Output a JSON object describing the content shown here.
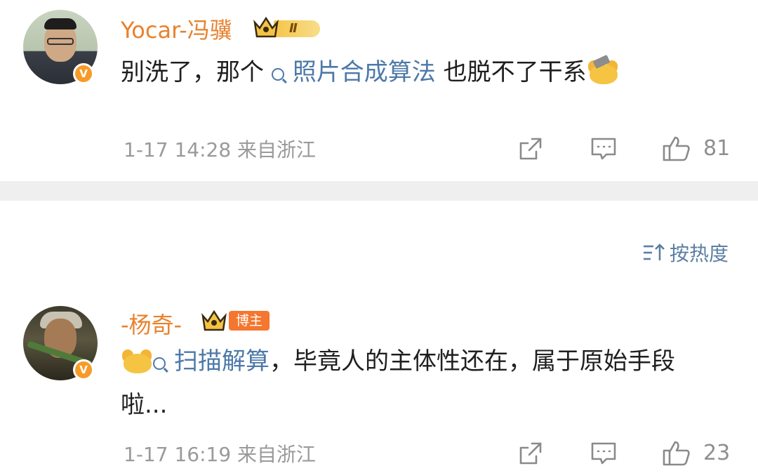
{
  "comments": [
    {
      "username": "Yocar-冯骥",
      "badge": "Ⅱ",
      "verified": "V",
      "text_before": "别洗了，那个",
      "link": "照片合成算法",
      "text_after": "也脱不了干系",
      "emoji": "hammer-emoji",
      "time": "1-17 14:28",
      "location": "来自浙江",
      "likes": "81"
    },
    {
      "username": "-杨奇-",
      "badge": "博主",
      "verified": "V",
      "emoji": "facepalm-emoji",
      "link": "扫描解算",
      "text_after": "，毕竟人的主体性还在，属于原始手段啦...",
      "time": "1-17 16:19",
      "location": "来自浙江",
      "likes": "23"
    }
  ],
  "sort": {
    "label": "按热度"
  },
  "colors": {
    "username": "#e8822e",
    "link": "#4d79a8",
    "meta": "#9a9a9a",
    "divider": "#efefef"
  }
}
